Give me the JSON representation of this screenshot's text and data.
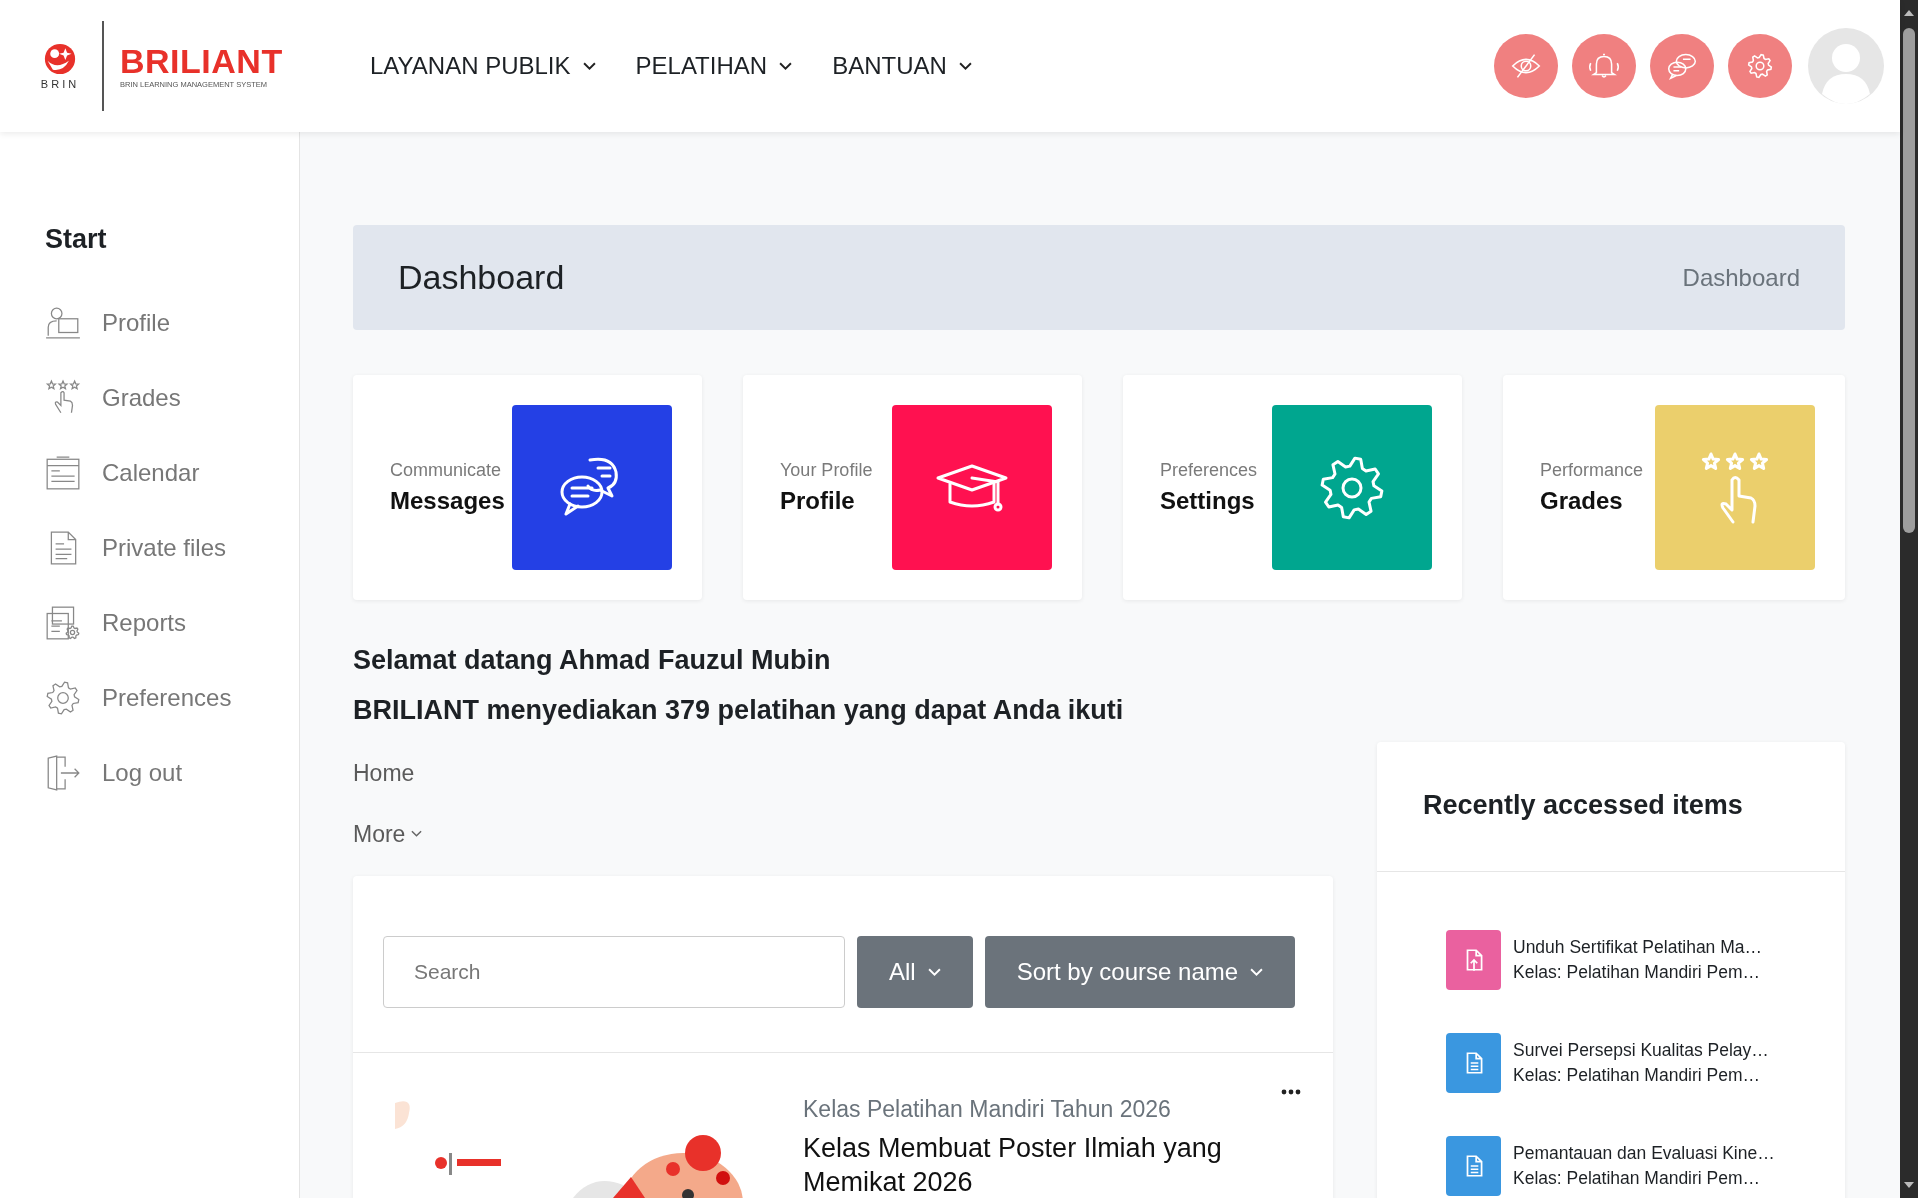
{
  "header": {
    "logo": {
      "agency": "BRIN",
      "brand": "BRILIANT",
      "tagline": "BRIN LEARNING MANAGEMENT SYSTEM"
    },
    "nav": [
      {
        "label": "LAYANAN PUBLIK"
      },
      {
        "label": "PELATIHAN"
      },
      {
        "label": "BANTUAN"
      }
    ],
    "actions": [
      {
        "kind": "hide"
      },
      {
        "kind": "bell"
      },
      {
        "kind": "chat"
      },
      {
        "kind": "gear"
      }
    ]
  },
  "sidebar": {
    "heading": "Start",
    "items": [
      {
        "label": "Profile",
        "kind": "profile"
      },
      {
        "label": "Grades",
        "kind": "grades"
      },
      {
        "label": "Calendar",
        "kind": "calendar"
      },
      {
        "label": "Private files",
        "kind": "file"
      },
      {
        "label": "Reports",
        "kind": "reports"
      },
      {
        "label": "Preferences",
        "kind": "gear"
      },
      {
        "label": "Log out",
        "kind": "logout"
      }
    ]
  },
  "page_header": {
    "title": "Dashboard",
    "breadcrumb": "Dashboard"
  },
  "cards": [
    {
      "caption": "Communicate",
      "label": "Messages",
      "kind": "chat",
      "color": "#2440e5"
    },
    {
      "caption": "Your Profile",
      "label": "Profile",
      "kind": "cap",
      "color": "#ff1150"
    },
    {
      "caption": "Preferences",
      "label": "Settings",
      "kind": "gear",
      "color": "#00a68f"
    },
    {
      "caption": "Performance",
      "label": "Grades",
      "kind": "grades",
      "color": "#ebcf6c"
    }
  ],
  "welcome": {
    "greeting": "Selamat datang Ahmad Fauzul Mubin",
    "summary": "BRILIANT menyediakan 379 pelatihan yang dapat Anda ikuti"
  },
  "links": {
    "home": "Home",
    "more": "More"
  },
  "courses": {
    "search": {
      "placeholder": "Search"
    },
    "filter": "All",
    "sort": "Sort by course name",
    "items": [
      {
        "category": "Kelas Pelatihan Mandiri Tahun 2026",
        "title": "Kelas Membuat Poster Ilmiah yang Memikat 2026"
      }
    ]
  },
  "recent": {
    "title": "Recently accessed items",
    "items": [
      {
        "name": "Unduh Sertifikat Pelatihan Ma…",
        "course": "Kelas: Pelatihan Mandiri Pem…",
        "kind": "upload",
        "color": "#ea619f"
      },
      {
        "name": "Survei Persepsi Kualitas Pelay…",
        "course": "Kelas: Pelatihan Mandiri Pem…",
        "kind": "doc",
        "color": "#3a97e0"
      },
      {
        "name": "Pemantauan dan Evaluasi Kine…",
        "course": "Kelas: Pelatihan Mandiri Pem…",
        "kind": "doc",
        "color": "#3a97e0"
      }
    ]
  }
}
